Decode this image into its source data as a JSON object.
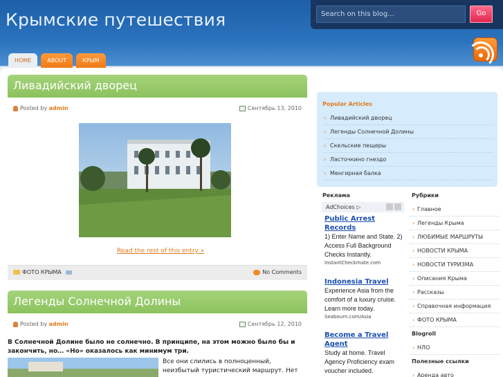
{
  "site": {
    "title": "Крымские путешествия"
  },
  "search": {
    "placeholder": "Search on this blog...",
    "button": "Go"
  },
  "nav": {
    "tabs": [
      "HOME",
      "ABOUT",
      "КРЫМ"
    ]
  },
  "posts": [
    {
      "title": "Ливадийский дворец",
      "posted_by_label": "Posted by",
      "author": "admin",
      "date": "Сентябрь 13, 2010",
      "read_more": "Read the rest of this entry »",
      "category": "ФОТО КРЫМА",
      "comments": "No Comments"
    },
    {
      "title": "Легенды Солнечной Долины",
      "posted_by_label": "Posted by",
      "author": "admin",
      "date": "Сентябрь 12, 2010",
      "intro": "В Солнечной Долине было не солнечно. В принципе, на этом можно было бы и закончить, но… «Но» оказалось как минимум три.",
      "text": "Все они слились в полноценный, неизбытый туристический маршрут. Нет ничего луч"
    }
  ],
  "popular": {
    "title": "Popular Articles",
    "items": [
      "Ливадийский дворец",
      "Легенды Солнечной Долины",
      "Скельские пещеры",
      "Ласточкино гнездо",
      "Менгирная балка"
    ]
  },
  "ads": {
    "title": "Реклама",
    "adchoices": "AdChoices",
    "items": [
      {
        "headline": "Public Arrest Records",
        "body": "1) Enter Name and State. 2) Access Full Background Checks Instantly.",
        "url": "InstantCheckmate.com"
      },
      {
        "headline": "Indonesia Travel",
        "body": "Experience Asia from the comfort of a luxury cruise. Learn more today.",
        "url": "Seabourn.com/Asia"
      },
      {
        "headline": "Become a Travel Agent",
        "body": "Study at home. Travel Agency Proficiency exam voucher included.",
        "url": ""
      }
    ]
  },
  "rubrics": {
    "title": "Рубрики",
    "items": [
      "Главное",
      "Легенды Крыма",
      "ЛЮБИМЫЕ МАРШРУТЫ",
      "НОВОСТИ КРЫМА",
      "НОВОСТИ ТУРИЗМА",
      "Описания Крыма",
      "Рассказы",
      "Справочная информация",
      "ФОТО КРЫМА"
    ]
  },
  "blogroll": {
    "title": "Blogroll",
    "items": [
      "НЛО"
    ]
  },
  "links": {
    "title": "Полезные ссылки",
    "items": [
      "Аренда авто"
    ]
  }
}
